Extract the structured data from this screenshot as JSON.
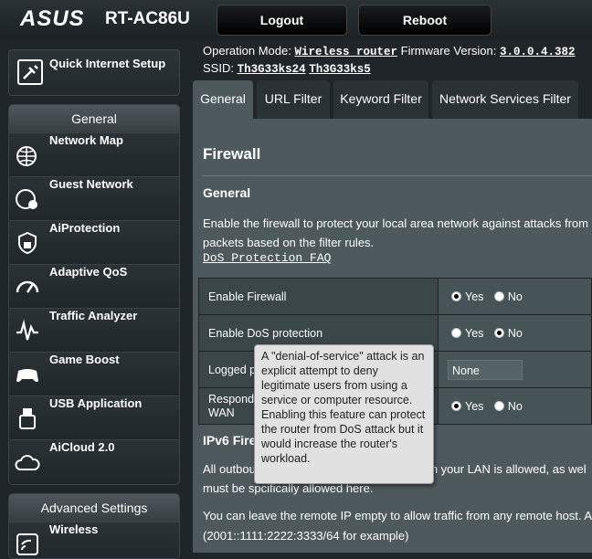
{
  "header": {
    "logo": "ASUS",
    "model": "RT-AC86U",
    "logout_label": "Logout",
    "reboot_label": "Reboot",
    "operation_mode_label": "Operation Mode:",
    "operation_mode_value": "Wireless router",
    "firmware_label": "Firmware Version:",
    "firmware_value": "3.0.0.4.382",
    "ssid_label": "SSID:",
    "ssid_1": "Th3G33ks24",
    "ssid_2": "Th3G33ks5"
  },
  "sidebar": {
    "quick_setup": "Quick Internet Setup",
    "general_header": "General",
    "general_items": [
      {
        "label": "Network Map",
        "icon": "network-map-icon"
      },
      {
        "label": "Guest Network",
        "icon": "guest-network-icon"
      },
      {
        "label": "AiProtection",
        "icon": "aiprotection-icon"
      },
      {
        "label": "Adaptive QoS",
        "icon": "qos-icon"
      },
      {
        "label": "Traffic Analyzer",
        "icon": "traffic-analyzer-icon"
      },
      {
        "label": "Game Boost",
        "icon": "gamepad-icon"
      },
      {
        "label": "USB Application",
        "icon": "usb-icon"
      },
      {
        "label": "AiCloud 2.0",
        "icon": "cloud-icon"
      }
    ],
    "advanced_header": "Advanced Settings",
    "advanced_items": [
      {
        "label": "Wireless",
        "icon": "wireless-icon"
      }
    ]
  },
  "tabs": [
    "General",
    "URL Filter",
    "Keyword Filter",
    "Network Services Filter"
  ],
  "main": {
    "title": "Firewall",
    "general_heading": "General",
    "desc_line1": "Enable the firewall to protect your local area network against attacks from",
    "desc_line2": "packets based on the filter rules.",
    "faq_link": "DoS Protection FAQ",
    "rows": {
      "enable_firewall": "Enable Firewall",
      "enable_dos": "Enable DoS protection",
      "logged": "Logged p",
      "respond1": "Respond",
      "respond2": "WAN"
    },
    "yes": "Yes",
    "no": "No",
    "logged_value": "None",
    "ipv6_heading": "IPv6 Fire",
    "p2_line1a": "All outbou",
    "p2_line1b": "n your LAN is allowed, as wel",
    "p2_line2": "must be sp",
    "p2_line2b": "cifically allowed here.",
    "p3_line1": "You can leave the remote IP empty to allow traffic from any remote host. A",
    "p3_line2": "(2001::1111:2222:3333/64 for example)"
  },
  "tooltip": {
    "p1": "A \"denial-of-service\" attack is an explicit attempt to deny legitimate users from using a service or computer resource.",
    "p2": "Enabling this feature can protect the router from DoS attack but it would increase the router's workload."
  }
}
